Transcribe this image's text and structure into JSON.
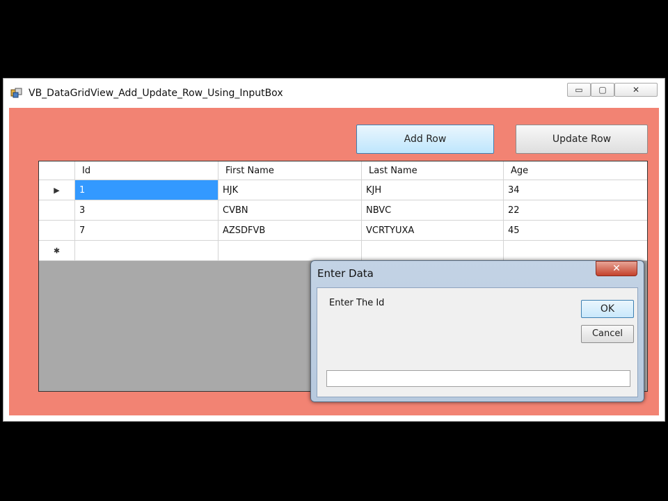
{
  "window": {
    "title": "VB_DataGridView_Add_Update_Row_Using_InputBox",
    "controls": {
      "minimize": "▭",
      "maximize": "▢",
      "close": "✕"
    }
  },
  "toolbar": {
    "add_row_label": "Add Row",
    "update_row_label": "Update Row"
  },
  "grid": {
    "columns": [
      "Id",
      "First Name",
      "Last Name",
      "Age"
    ],
    "rows": [
      {
        "marker": "▶",
        "id": "1",
        "first": "HJK",
        "last": "KJH",
        "age": "34"
      },
      {
        "marker": "",
        "id": "3",
        "first": "CVBN",
        "last": "NBVC",
        "age": "22"
      },
      {
        "marker": "",
        "id": "7",
        "first": "AZSDFVB",
        "last": "VCRTYUXA",
        "age": "45"
      }
    ],
    "new_row_marker": "✱"
  },
  "dialog": {
    "title": "Enter Data",
    "close_glyph": "✕",
    "prompt": "Enter The Id",
    "ok_label": "OK",
    "cancel_label": "Cancel",
    "input_value": ""
  },
  "colors": {
    "form_background": "#f28373",
    "grid_background": "#a9a9a9",
    "selection": "#3399ff"
  }
}
